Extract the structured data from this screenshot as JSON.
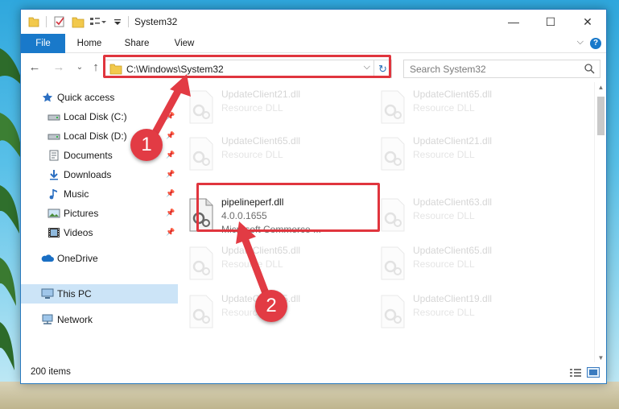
{
  "window": {
    "title": "System32",
    "controls": {
      "minimize": "—",
      "maximize": "☐",
      "close": "✕"
    }
  },
  "ribbon": {
    "tabs": [
      "File",
      "Home",
      "Share",
      "View"
    ],
    "help": "?"
  },
  "navigation": {
    "address": "C:\\Windows\\System32",
    "search_placeholder": "Search System32"
  },
  "sidebar": {
    "items": [
      {
        "label": "Quick access",
        "icon": "star-icon",
        "pinned": false
      },
      {
        "label": "Local Disk (C:)",
        "icon": "drive-icon",
        "pinned": true
      },
      {
        "label": "Local Disk (D:)",
        "icon": "drive-icon",
        "pinned": true
      },
      {
        "label": "Documents",
        "icon": "documents-icon",
        "pinned": true
      },
      {
        "label": "Downloads",
        "icon": "download-icon",
        "pinned": true
      },
      {
        "label": "Music",
        "icon": "music-icon",
        "pinned": true
      },
      {
        "label": "Pictures",
        "icon": "pictures-icon",
        "pinned": true
      },
      {
        "label": "Videos",
        "icon": "videos-icon",
        "pinned": true
      },
      {
        "label": "OneDrive",
        "icon": "cloud-icon",
        "pinned": false
      },
      {
        "label": "This PC",
        "icon": "computer-icon",
        "pinned": false,
        "selected": true
      },
      {
        "label": "Network",
        "icon": "network-icon",
        "pinned": false
      }
    ]
  },
  "files": [
    {
      "name": "UpdateClient21.dll",
      "type": "Resource DLL",
      "faded": true
    },
    {
      "name": "UpdateClient65.dll",
      "type": "Resource DLL",
      "faded": true
    },
    {
      "name": "UpdateClient65.dll",
      "type": "Resource DLL",
      "faded": true
    },
    {
      "name": "UpdateClient21.dll",
      "type": "Resource DLL",
      "faded": true
    },
    {
      "name": "pipelineperf.dll",
      "version": "4.0.0.1655",
      "company": "Microsoft Commerce ...",
      "faded": false
    },
    {
      "name": "UpdateClient63.dll",
      "type": "Resource DLL",
      "faded": true
    },
    {
      "name": "UpdateClient65.dll",
      "type": "Resource DLL",
      "faded": true
    },
    {
      "name": "UpdateClient65.dll",
      "type": "Resource DLL",
      "faded": true
    },
    {
      "name": "UpdateClient65.dll",
      "type": "Resource DLL",
      "faded": true
    },
    {
      "name": "UpdateClient19.dll",
      "type": "Resource DLL",
      "faded": true
    }
  ],
  "status": {
    "item_count": "200 items"
  },
  "annotations": {
    "step1": "1",
    "step2": "2",
    "highlight_color": "#e0353e"
  },
  "colors": {
    "accent": "#1979ca",
    "selection": "#cce4f7",
    "annotation": "#e23b44"
  }
}
